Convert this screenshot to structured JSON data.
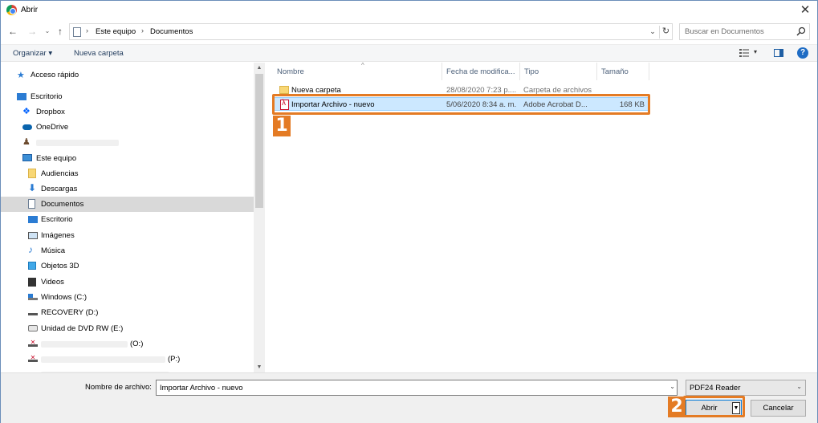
{
  "window": {
    "title": "Abrir"
  },
  "address": {
    "breadcrumbs": [
      "Este equipo",
      "Documentos"
    ],
    "search_placeholder": "Buscar en Documentos"
  },
  "toolbar": {
    "organize_label": "Organizar ▾",
    "new_folder_label": "Nueva carpeta"
  },
  "nav_pane": {
    "items": [
      {
        "label": "Acceso rápido",
        "icon": "star-icon"
      },
      {
        "label": "Escritorio",
        "icon": "desktop-icon"
      },
      {
        "label": "Dropbox",
        "icon": "dropbox-icon"
      },
      {
        "label": "OneDrive",
        "icon": "cloud-icon"
      },
      {
        "label": "",
        "icon": "user-icon"
      },
      {
        "label": "Este equipo",
        "icon": "computer-icon"
      },
      {
        "label": "Audiencias",
        "icon": "folder-icon"
      },
      {
        "label": "Descargas",
        "icon": "download-icon"
      },
      {
        "label": "Documentos",
        "icon": "documents-icon",
        "selected": true
      },
      {
        "label": "Escritorio",
        "icon": "desktop-icon"
      },
      {
        "label": "Imágenes",
        "icon": "pictures-icon"
      },
      {
        "label": "Música",
        "icon": "music-icon"
      },
      {
        "label": "Objetos 3D",
        "icon": "cube-icon"
      },
      {
        "label": "Videos",
        "icon": "video-icon"
      },
      {
        "label": "Windows (C:)",
        "icon": "windows-drive-icon"
      },
      {
        "label": "RECOVERY (D:)",
        "icon": "drive-icon"
      },
      {
        "label": "Unidad de DVD RW (E:)",
        "icon": "dvd-icon"
      },
      {
        "label": "(O:)",
        "icon": "network-drive-icon"
      },
      {
        "label": "(P:)",
        "icon": "network-drive-icon"
      }
    ]
  },
  "file_list": {
    "columns": [
      "Nombre",
      "Fecha de modifica...",
      "Tipo",
      "Tamaño"
    ],
    "rows": [
      {
        "name": "Nueva carpeta",
        "date": "28/08/2020 7:23 p....",
        "type": "Carpeta de archivos",
        "size": "",
        "icon": "folder-icon"
      },
      {
        "name": "Importar Archivo - nuevo",
        "date": "5/06/2020 8:34 a. m.",
        "type": "Adobe Acrobat D...",
        "size": "168 KB",
        "icon": "pdf-icon",
        "selected": true
      }
    ]
  },
  "bottom": {
    "filename_label": "Nombre de archivo:",
    "filename_value": "Importar Archivo - nuevo",
    "filetype_value": "PDF24 Reader",
    "open_label": "Abrir",
    "cancel_label": "Cancelar"
  },
  "annotations": {
    "step1": "1",
    "step2": "2"
  },
  "colors": {
    "annotation": "#e47b24",
    "selection": "#cce8ff",
    "accent": "#0078d7"
  }
}
